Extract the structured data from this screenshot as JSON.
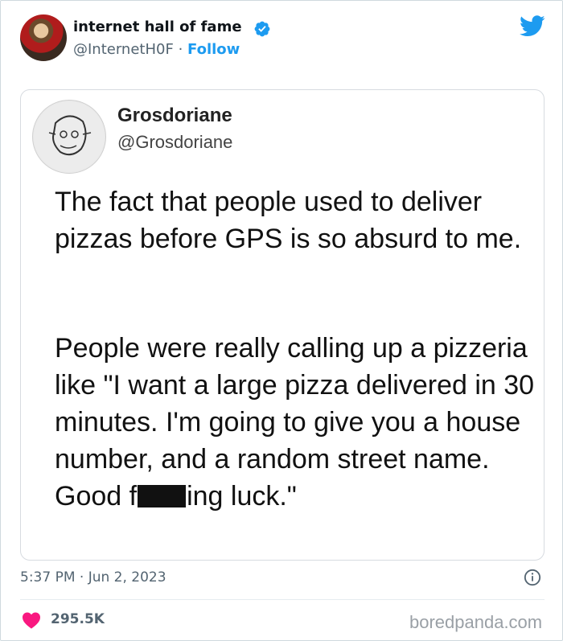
{
  "tweet": {
    "author_name": "internet hall of fame",
    "author_handle": "@InternetH0F",
    "separator": "·",
    "follow_label": "Follow",
    "timestamp": "5:37 PM · Jun 2, 2023",
    "likes": "295.5K",
    "icons": [
      "verified-badge-icon",
      "twitter-bird-icon",
      "info-icon",
      "heart-icon"
    ]
  },
  "quoted": {
    "name": "Grosdoriane",
    "handle": "@Grosdoriane",
    "paragraph1": "The fact that people used to deliver pizzas before GPS is so absurd to me.",
    "paragraph2_before": "People were really calling up a pizzeria like \"I want a large pizza delivered in 30 minutes. I'm going to give you a house number, and a random street name. Good f",
    "paragraph2_after": "ing luck.\""
  },
  "watermark": "boredpanda.com",
  "colors": {
    "accent": "#1d9bf0",
    "heart": "#f91880",
    "secondary_text": "#536471"
  }
}
